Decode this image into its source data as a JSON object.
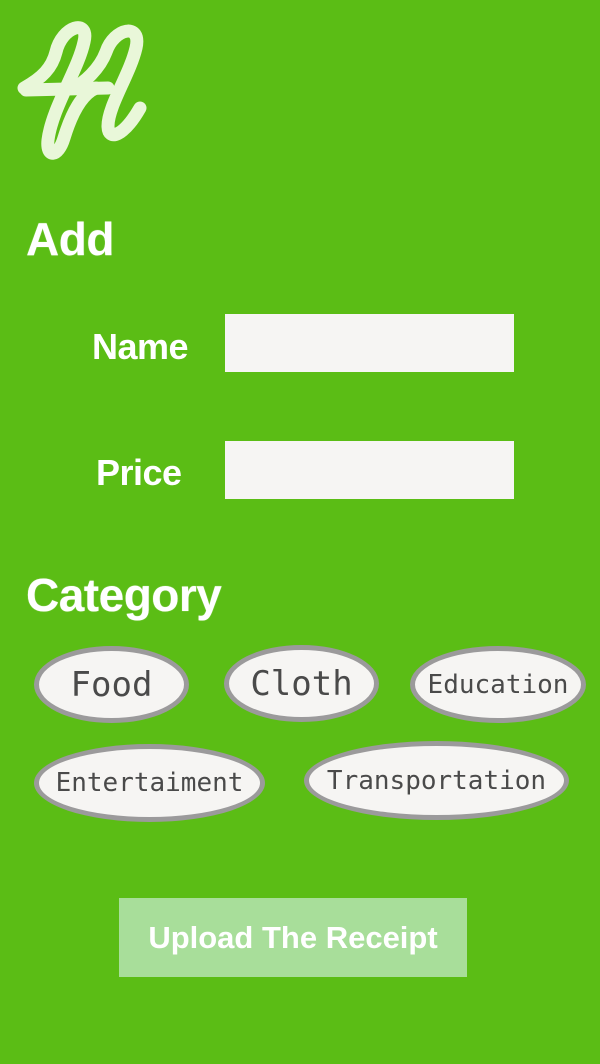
{
  "app": {
    "logo_name": "fl-script-logo",
    "background_color": "#5bbd15"
  },
  "add_section": {
    "title": "Add",
    "fields": {
      "name": {
        "label": "Name",
        "value": "",
        "placeholder": ""
      },
      "price": {
        "label": "Price",
        "value": "",
        "placeholder": ""
      }
    }
  },
  "category_section": {
    "title": "Category",
    "chips": [
      "Food",
      "Cloth",
      "Education",
      "Entertaiment",
      "Transportation"
    ],
    "chip_background": "#f6f5f3",
    "chip_border_color": "#9b9a9b"
  },
  "upload_button": {
    "label": "Upload The Receipt",
    "background_color": "#a8de9a"
  }
}
